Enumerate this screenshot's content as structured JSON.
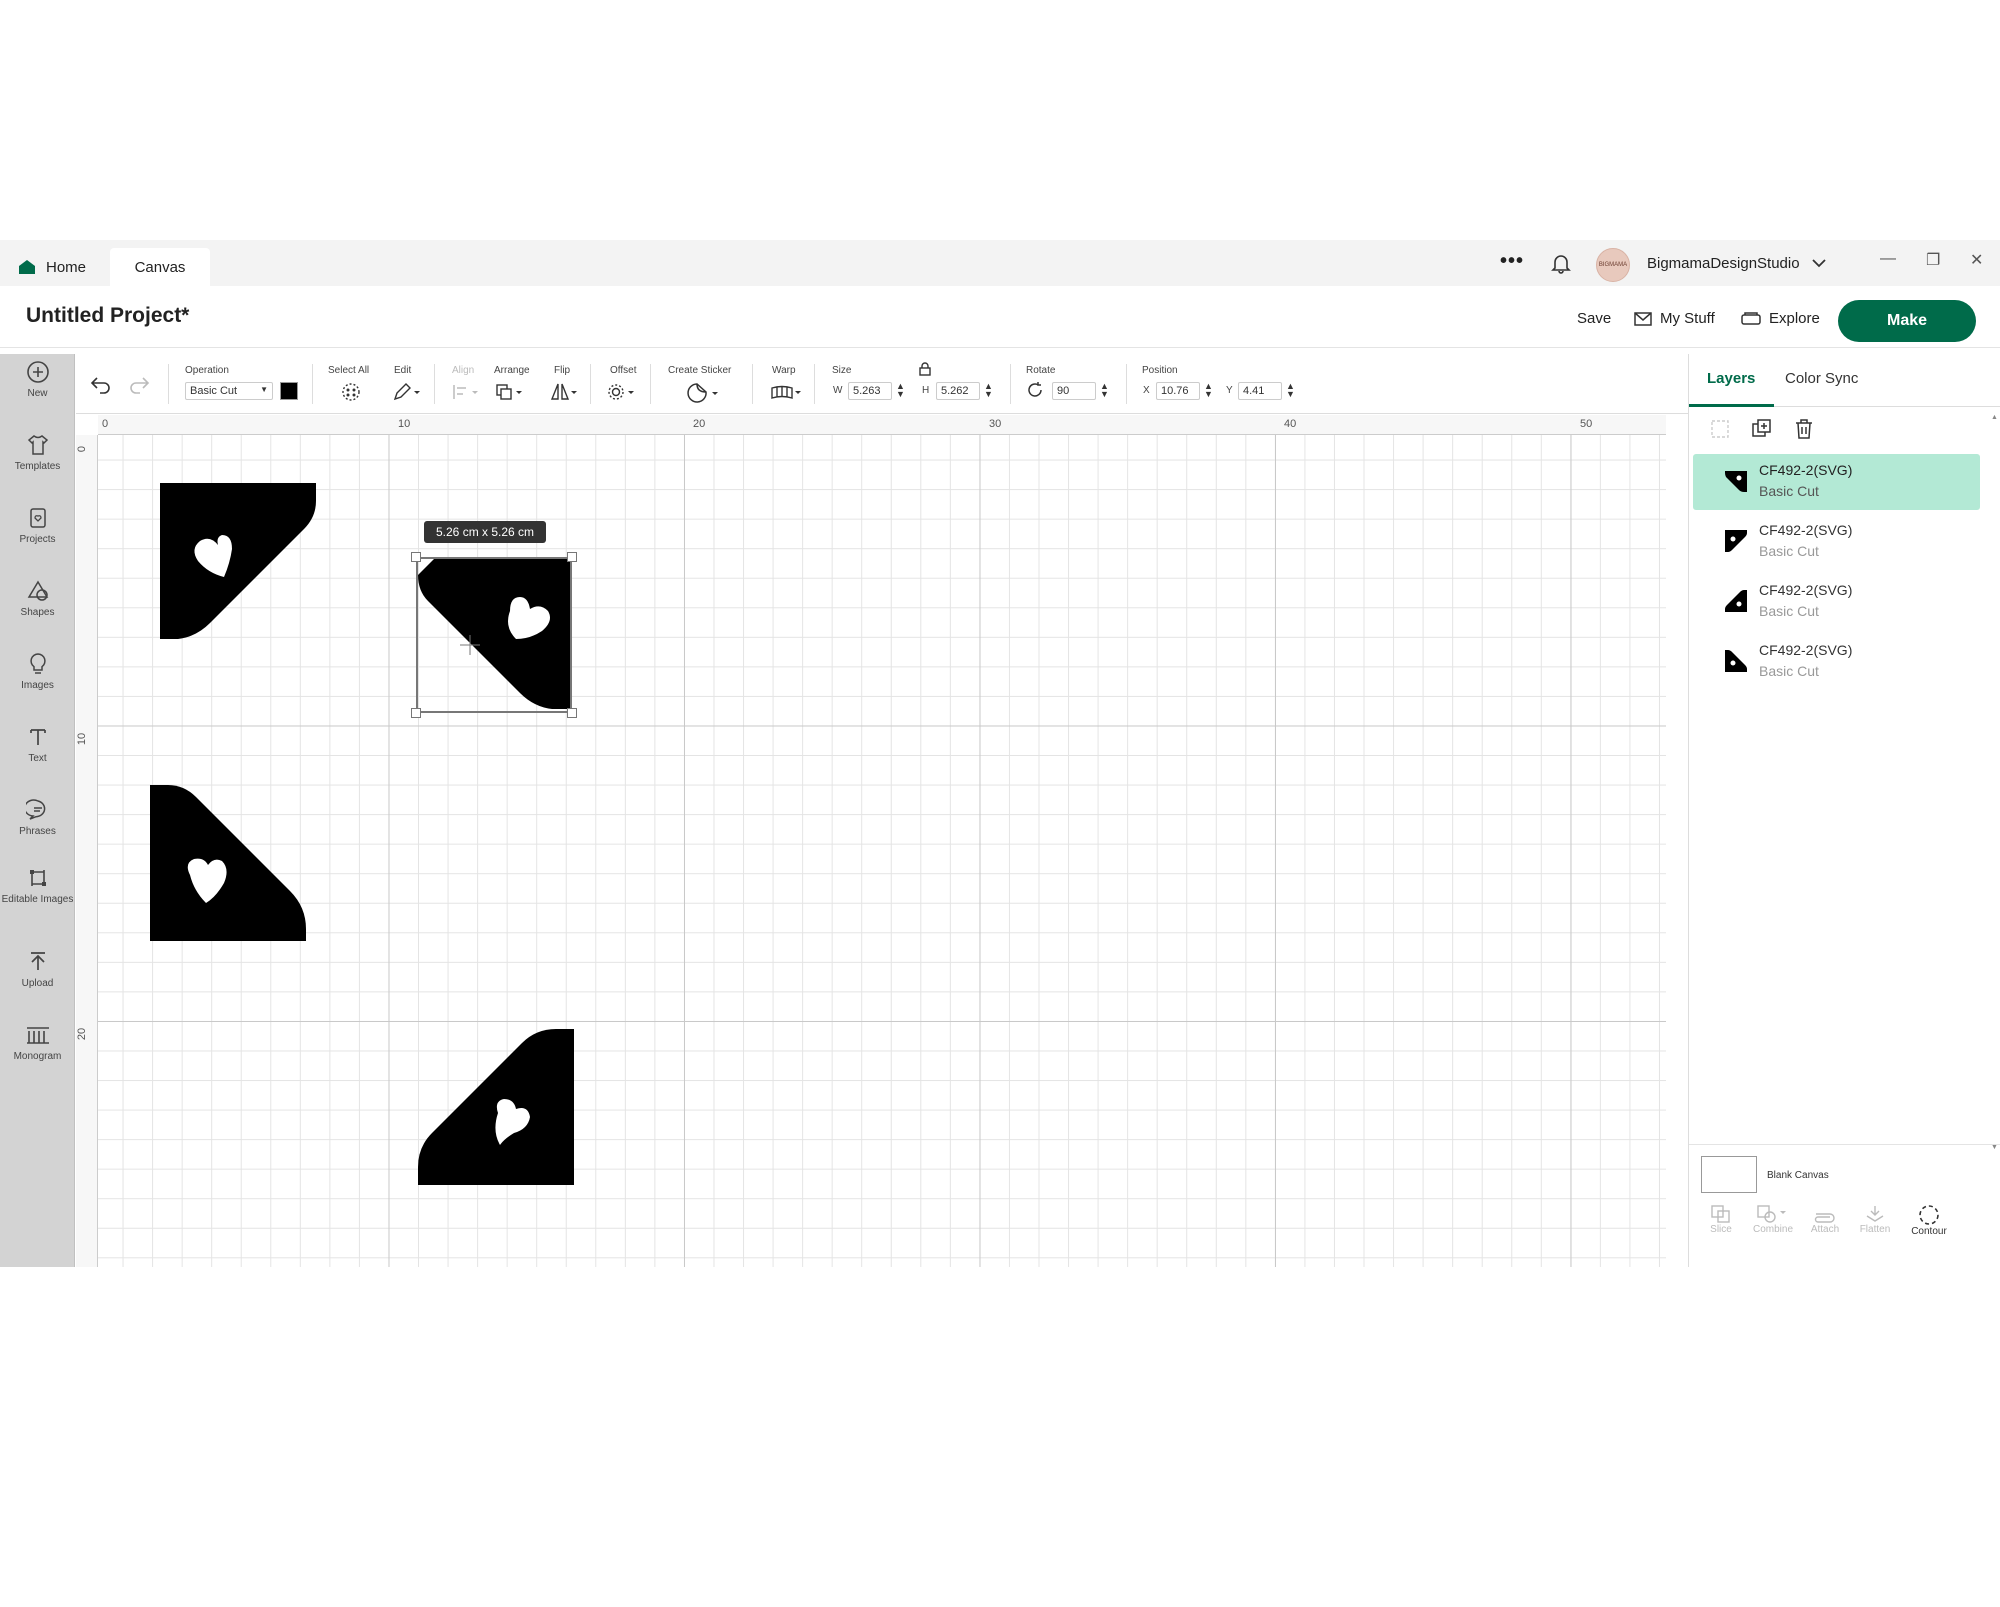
{
  "tabs": {
    "home": "Home",
    "canvas": "Canvas"
  },
  "account": {
    "name": "BigmamaDesignStudio",
    "avatar_text": "BIGMAMA"
  },
  "project": {
    "title": "Untitled Project*"
  },
  "header": {
    "save": "Save",
    "my_stuff": "My Stuff",
    "explore": "Explore",
    "make": "Make"
  },
  "sidebar": {
    "items": [
      {
        "label": "New",
        "icon": "plus-circle-icon"
      },
      {
        "label": "Templates",
        "icon": "shirt-icon"
      },
      {
        "label": "Projects",
        "icon": "projects-icon"
      },
      {
        "label": "Shapes",
        "icon": "shapes-icon"
      },
      {
        "label": "Images",
        "icon": "lightbulb-icon"
      },
      {
        "label": "Text",
        "icon": "text-icon"
      },
      {
        "label": "Phrases",
        "icon": "speech-bubble-icon"
      },
      {
        "label": "Editable Images",
        "icon": "editable-images-icon"
      },
      {
        "label": "Upload",
        "icon": "upload-icon"
      },
      {
        "label": "Monogram",
        "icon": "monogram-icon"
      }
    ]
  },
  "toolbar": {
    "operation_label": "Operation",
    "operation_value": "Basic Cut",
    "select_all": "Select All",
    "edit": "Edit",
    "align": "Align",
    "arrange": "Arrange",
    "flip": "Flip",
    "offset": "Offset",
    "create_sticker": "Create Sticker",
    "warp": "Warp",
    "size": "Size",
    "w_label": "W",
    "w_value": "5.263",
    "h_label": "H",
    "h_value": "5.262",
    "rotate": "Rotate",
    "rotate_value": "90",
    "position": "Position",
    "x_label": "X",
    "x_value": "10.76",
    "y_label": "Y",
    "y_value": "4.41"
  },
  "rulers": {
    "top": [
      "0",
      "10",
      "20",
      "30",
      "40",
      "50"
    ],
    "left": [
      "0",
      "10",
      "20"
    ]
  },
  "canvas": {
    "size_tooltip": "5.26  cm x 5.26  cm"
  },
  "panel": {
    "tabs": {
      "layers": "Layers",
      "color_sync": "Color Sync"
    },
    "layers": [
      {
        "name": "CF492-2(SVG)",
        "operation": "Basic Cut",
        "selected": true
      },
      {
        "name": "CF492-2(SVG)",
        "operation": "Basic Cut",
        "selected": false
      },
      {
        "name": "CF492-2(SVG)",
        "operation": "Basic Cut",
        "selected": false
      },
      {
        "name": "CF492-2(SVG)",
        "operation": "Basic Cut",
        "selected": false
      }
    ],
    "blank_canvas": "Blank Canvas",
    "bottom_tools": [
      "Slice",
      "Combine",
      "Attach",
      "Flatten",
      "Contour"
    ]
  },
  "colors": {
    "accent": "#006b4a",
    "layer_selected": "#b3e9d5",
    "shape_fill": "#000000"
  }
}
